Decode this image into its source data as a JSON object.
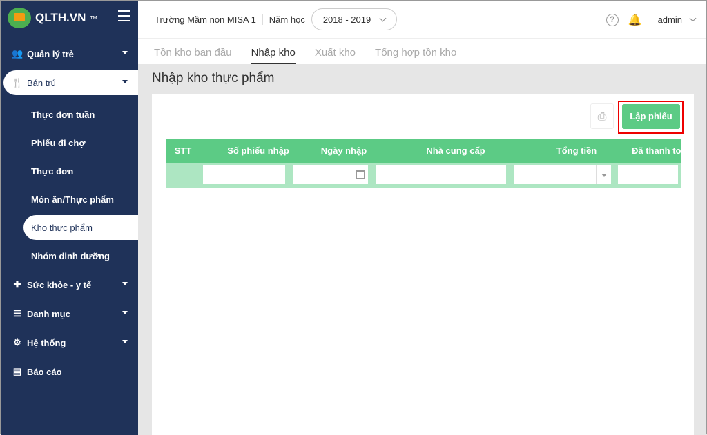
{
  "logo": {
    "text": "QLTH.VN",
    "tm": "TM"
  },
  "sidebar": {
    "items": [
      {
        "label": "Quản lý trẻ",
        "icon": "users-icon"
      },
      {
        "label": "Bán trú",
        "icon": "utensils-icon"
      },
      {
        "label": "Sức khỏe - y tế",
        "icon": "medkit-icon"
      },
      {
        "label": "Danh mục",
        "icon": "list-icon"
      },
      {
        "label": "Hệ thống",
        "icon": "gear-icon"
      },
      {
        "label": "Báo cáo",
        "icon": "report-icon"
      }
    ],
    "subitems": [
      "Thực đơn tuần",
      "Phiếu đi chợ",
      "Thực đơn",
      "Món ăn/Thực phẩm",
      "Kho thực phẩm",
      "Nhóm dinh dưỡng"
    ]
  },
  "header": {
    "school": "Trường Mầm non MISA 1",
    "year_label": "Năm học",
    "year": "2018 - 2019",
    "user": "admin"
  },
  "tabs": [
    "Tồn kho ban đầu",
    "Nhập kho",
    "Xuất kho",
    "Tổng hợp tồn kho"
  ],
  "page_title": "Nhập kho thực phẩm",
  "toolbar": {
    "create_label": "Lập phiếu"
  },
  "table": {
    "columns": [
      "STT",
      "Số phiếu nhập",
      "Ngày nhập",
      "Nhà cung cấp",
      "Tổng tiền",
      "Đã thanh toán"
    ]
  },
  "colors": {
    "sidebar": "#1f3259",
    "accent": "#5ccb85",
    "filter": "#ade6c2"
  }
}
